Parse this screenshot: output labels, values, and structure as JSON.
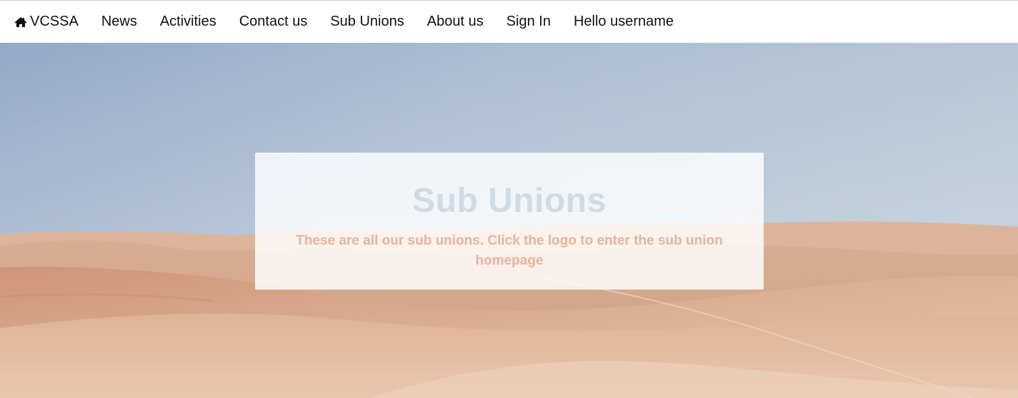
{
  "navbar": {
    "brand": {
      "icon": "home-icon",
      "label": "VCSSA"
    },
    "items": [
      {
        "label": "News"
      },
      {
        "label": "Activities"
      },
      {
        "label": "Contact us"
      },
      {
        "label": "Sub Unions"
      },
      {
        "label": "About us"
      },
      {
        "label": "Sign In"
      },
      {
        "label": "Hello username"
      }
    ]
  },
  "hero": {
    "background": "desert-landscape-image",
    "title": "Sub Unions",
    "subtitle": "These are all our sub unions. Click the logo to enter the sub union homepage"
  },
  "colors": {
    "sky_top": "#9fb3cd",
    "sand": "#dcae92",
    "title": "#cfdbe5",
    "subtitle": "#e7b59a"
  }
}
